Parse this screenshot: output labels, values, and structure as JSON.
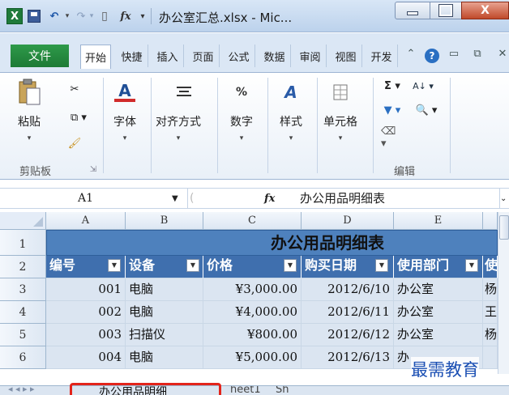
{
  "window": {
    "title": "办公室汇总.xlsx - Mic...",
    "close_glyph": "X"
  },
  "qat": {
    "app_icon_text": "X",
    "fx_text": "fx",
    "new_glyph": "▯"
  },
  "ribbon_tabs": {
    "file": "文件",
    "tabs": [
      "开始",
      "快捷",
      "插入",
      "页面",
      "公式",
      "数据",
      "审阅",
      "视图",
      "开发"
    ]
  },
  "ribbon": {
    "paste": "粘贴",
    "font": "字体",
    "align": "对齐方式",
    "number": "数字",
    "number_icon": "%",
    "styles": "样式",
    "cells": "单元格",
    "clipboard_group": "剪贴板",
    "editing_group": "编辑",
    "font_icon": "A",
    "styles_icon": "A",
    "sigma": "Σ",
    "sort": "A↓",
    "find": "🔍"
  },
  "formula_bar": {
    "name_box": "A1",
    "fx": "fx",
    "content": "办公用品明细表"
  },
  "grid": {
    "columns": [
      "A",
      "B",
      "C",
      "D",
      "E"
    ],
    "rows": [
      "1",
      "2",
      "3",
      "4",
      "5",
      "6"
    ],
    "title": "办公用品明细表",
    "headers": [
      "编号",
      "设备",
      "价格",
      "购买日期",
      "使用部门",
      "使"
    ],
    "data": [
      [
        "001",
        "电脑",
        "¥3,000.00",
        "2012/6/10",
        "办公室",
        "杨"
      ],
      [
        "002",
        "电脑",
        "¥4,000.00",
        "2012/6/11",
        "办公室",
        "王"
      ],
      [
        "003",
        "扫描仪",
        "¥800.00",
        "2012/6/12",
        "办公室",
        "杨"
      ],
      [
        "004",
        "电脑",
        "¥5,000.00",
        "2012/6/13",
        "办",
        ""
      ]
    ]
  },
  "sheets": {
    "active": "办公用品明细",
    "other": "heet1",
    "other2": "Sh"
  },
  "watermark": "最需教育",
  "colors": {
    "title_fill": "#4e81bd",
    "header_fill": "#3f6fae",
    "data_fill": "#dbe5f1",
    "highlight": "#e3241b"
  }
}
